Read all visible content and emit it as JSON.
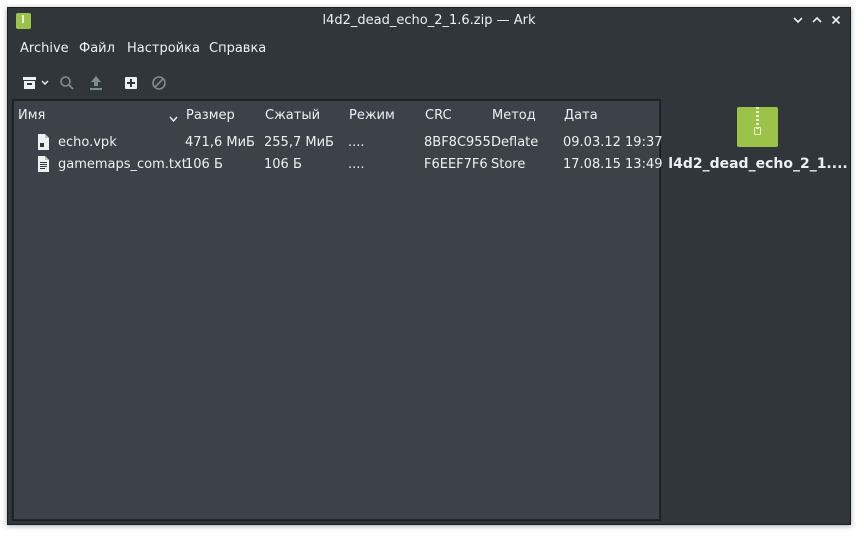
{
  "window": {
    "title": "l4d2_dead_echo_2_1.6.zip — Ark",
    "accent": "#9bc349"
  },
  "menu": [
    "Archive",
    "Файл",
    "Настройка",
    "Справка"
  ],
  "toolbar": [
    "archive-menu-icon",
    "search-icon",
    "extract-icon",
    "add-file-icon",
    "cancel-icon"
  ],
  "table": {
    "columns": [
      "Имя",
      "Размер",
      "Сжатый",
      "Режим",
      "CRC",
      "Метод",
      "Дата"
    ],
    "rows": [
      {
        "icon": "vpk-file-icon",
        "name": "echo.vpk",
        "size": "471,6 МиБ",
        "compressed": "255,7 МиБ",
        "mode": "....",
        "crc": "8BF8C955",
        "method": "Deflate",
        "date": "09.03.12 19:37"
      },
      {
        "icon": "text-file-icon",
        "name": "gamemaps_com.txt",
        "size": "106 Б",
        "compressed": "106 Б",
        "mode": "....",
        "crc": "F6EEF7F6",
        "method": "Store",
        "date": "17.08.15 13:49"
      }
    ]
  },
  "preview": {
    "name": "l4d2_dead_echo_2_1...."
  }
}
